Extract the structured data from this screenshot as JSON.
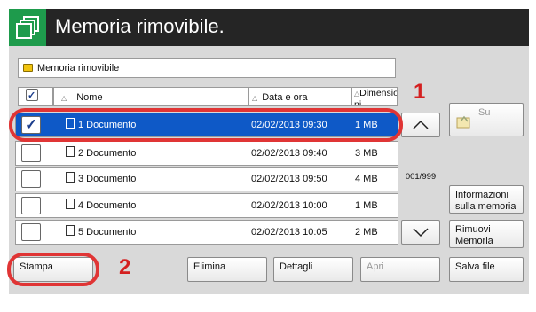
{
  "header": {
    "title": "Memoria rimovibile."
  },
  "path": {
    "label": "Memoria rimovibile"
  },
  "table": {
    "columns": {
      "name": "Nome",
      "date": "Data e ora",
      "size": "Dimensio ni"
    },
    "rows": [
      {
        "name": "1 Documento",
        "date": "02/02/2013 09:30",
        "size": "1 MB",
        "selected": true
      },
      {
        "name": "2 Documento",
        "date": "02/02/2013 09:40",
        "size": "3 MB",
        "selected": false
      },
      {
        "name": "3 Documento",
        "date": "02/02/2013 09:50",
        "size": "4 MB",
        "selected": false
      },
      {
        "name": "4 Documento",
        "date": "02/02/2013 10:00",
        "size": "1 MB",
        "selected": false
      },
      {
        "name": "5 Documento",
        "date": "02/02/2013 10:05",
        "size": "2 MB",
        "selected": false
      }
    ]
  },
  "pager": {
    "label": "001/999"
  },
  "side": {
    "up_label": "Su",
    "memory_info_label": "Informazioni sulla memoria",
    "remove_memory_label": "Rimuovi Memoria"
  },
  "bottom": {
    "print_label": "Stampa",
    "delete_label": "Elimina",
    "details_label": "Dettagli",
    "open_label": "Apri",
    "save_label": "Salva file"
  },
  "callouts": {
    "one": "1",
    "two": "2"
  },
  "colors": {
    "title_bg": "#252525",
    "accent_green": "#1e9b4c",
    "selection_blue": "#0e59c7",
    "callout_red": "#e03535"
  }
}
